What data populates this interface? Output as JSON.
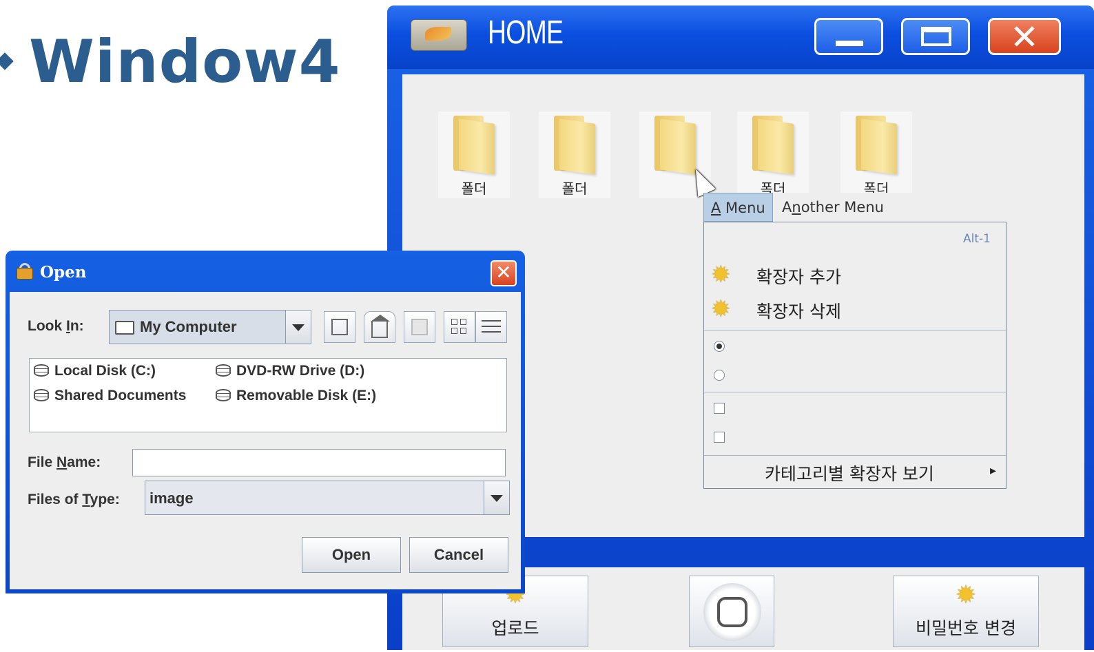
{
  "slide": {
    "title": "Window4"
  },
  "home_window": {
    "title": "HOME",
    "folders": [
      {
        "label": "폴더"
      },
      {
        "label": "폴더"
      },
      {
        "label": ""
      },
      {
        "label": "폭더"
      },
      {
        "label": "폭더"
      }
    ],
    "menubar": [
      {
        "label": "A Menu",
        "mnemonic": "A"
      },
      {
        "label": "Another Menu",
        "mnemonic": "n"
      }
    ],
    "popup": {
      "accelerator": "Alt-1",
      "items": [
        {
          "label": "확장자 추가",
          "icon": "star-burst-icon"
        },
        {
          "label": "확장자 삭제",
          "icon": "star-burst-icon"
        }
      ],
      "radios": [
        {
          "selected": true
        },
        {
          "selected": false
        }
      ],
      "checkboxes": [
        {
          "checked": false
        },
        {
          "checked": false
        }
      ],
      "submenu": {
        "label": "카테고리별 확장자 보기",
        "arrow": "▸"
      }
    },
    "bottom_buttons": [
      {
        "label": "업로드",
        "icon": "star-burst-icon"
      },
      {
        "label": "",
        "icon": "home-circle-icon"
      },
      {
        "label": "비밀번호 변경",
        "icon": "star-burst-icon"
      }
    ]
  },
  "open_dialog": {
    "title": "Open",
    "look_in_label": "Look In:",
    "look_in_mnemonic": "I",
    "look_in_value": "My Computer",
    "toolbar_icons": [
      "up-folder-icon",
      "home-icon",
      "new-folder-icon",
      "list-view-icon",
      "details-view-icon"
    ],
    "files": [
      {
        "name": "Local Disk (C:)"
      },
      {
        "name": "DVD-RW Drive (D:)"
      },
      {
        "name": "Shared Documents"
      },
      {
        "name": "Removable Disk (E:)"
      }
    ],
    "file_name_label": "File Name:",
    "file_name_mnemonic": "N",
    "file_name_value": "",
    "file_type_label": "Files of Type:",
    "file_type_mnemonic": "T",
    "file_type_value": "image",
    "open_label": "Open",
    "cancel_label": "Cancel"
  },
  "colors": {
    "title_blue": "#2c5d8f",
    "xp_titlebar": "#0b4fe0",
    "close_red": "#d8431e",
    "panel_gray": "#eeeeee",
    "menu_highlight": "#b8cfe5",
    "accel_text": "#6b86b3"
  }
}
